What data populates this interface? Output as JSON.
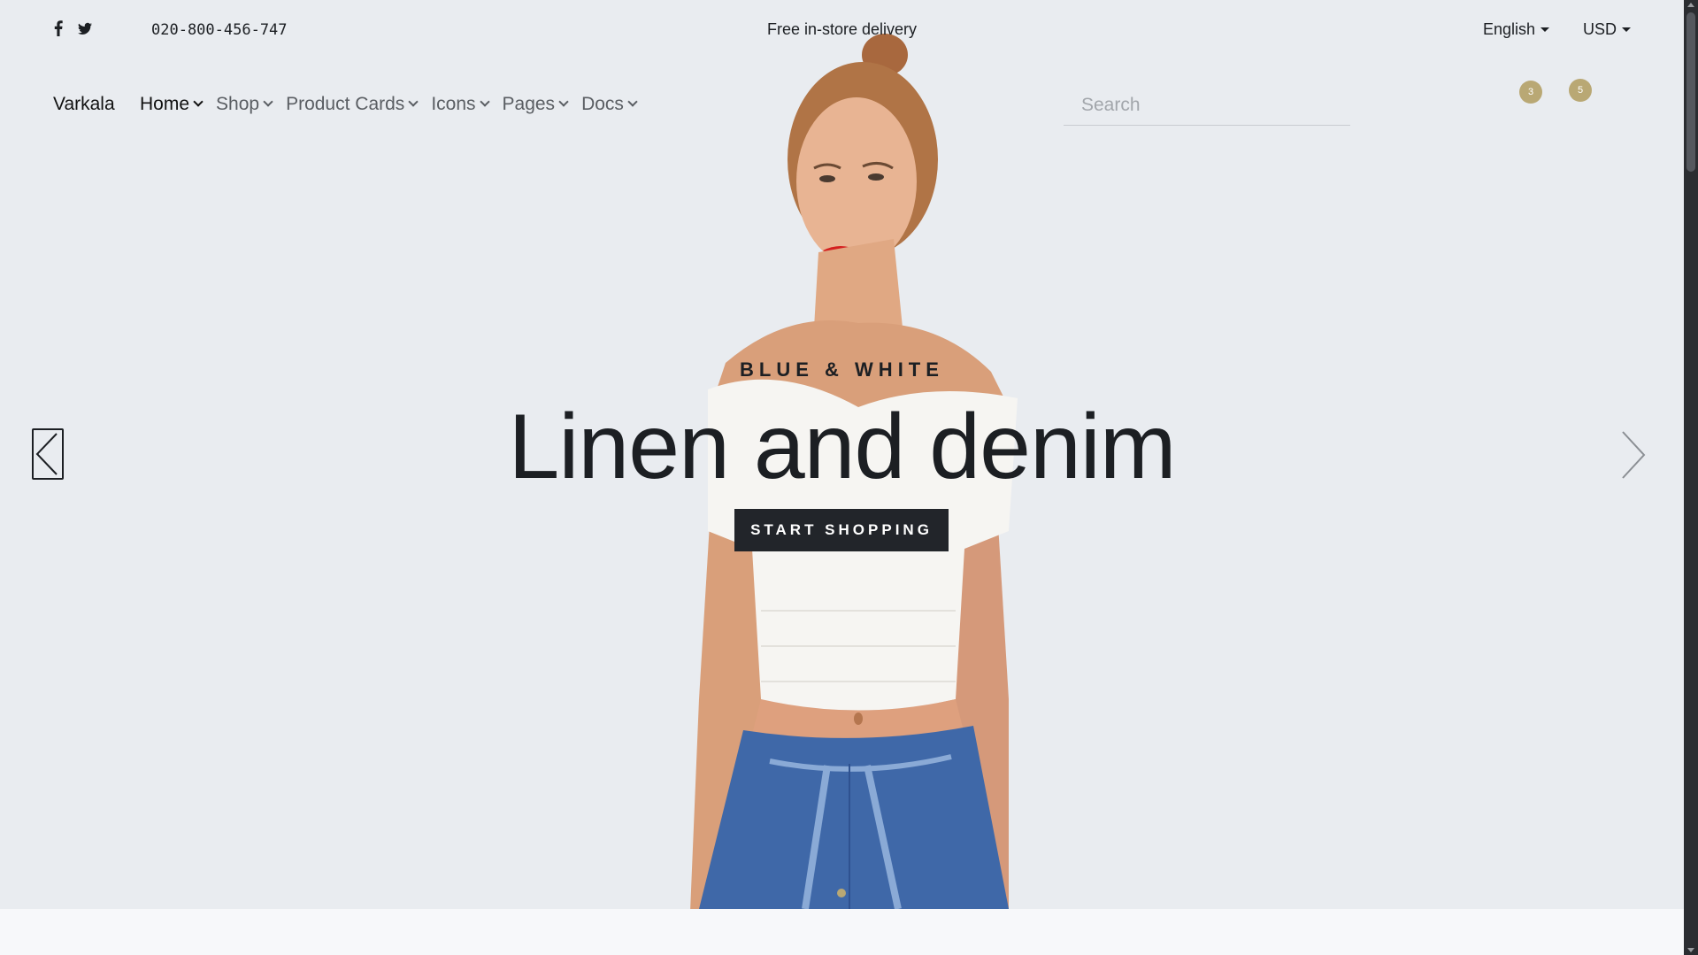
{
  "topbar": {
    "social": [
      {
        "name": "facebook-icon"
      },
      {
        "name": "twitter-icon"
      }
    ],
    "phone": "020-800-456-747",
    "promo": "Free in-store delivery",
    "language": "English",
    "currency": "USD"
  },
  "navbar": {
    "brand": "Varkala",
    "items": [
      {
        "label": "Home",
        "active": true
      },
      {
        "label": "Shop"
      },
      {
        "label": "Product Cards"
      },
      {
        "label": "Icons"
      },
      {
        "label": "Pages"
      },
      {
        "label": "Docs"
      }
    ],
    "search_placeholder": "Search",
    "cart_count": "3",
    "wishlist_count": "5"
  },
  "hero": {
    "eyebrow": "BLUE & WHITE",
    "headline": "Linen and denim",
    "cta_label": "START SHOPPING"
  },
  "colors": {
    "background": "#e9ecf0",
    "accent": "#b9a874",
    "dark": "#22252a"
  }
}
